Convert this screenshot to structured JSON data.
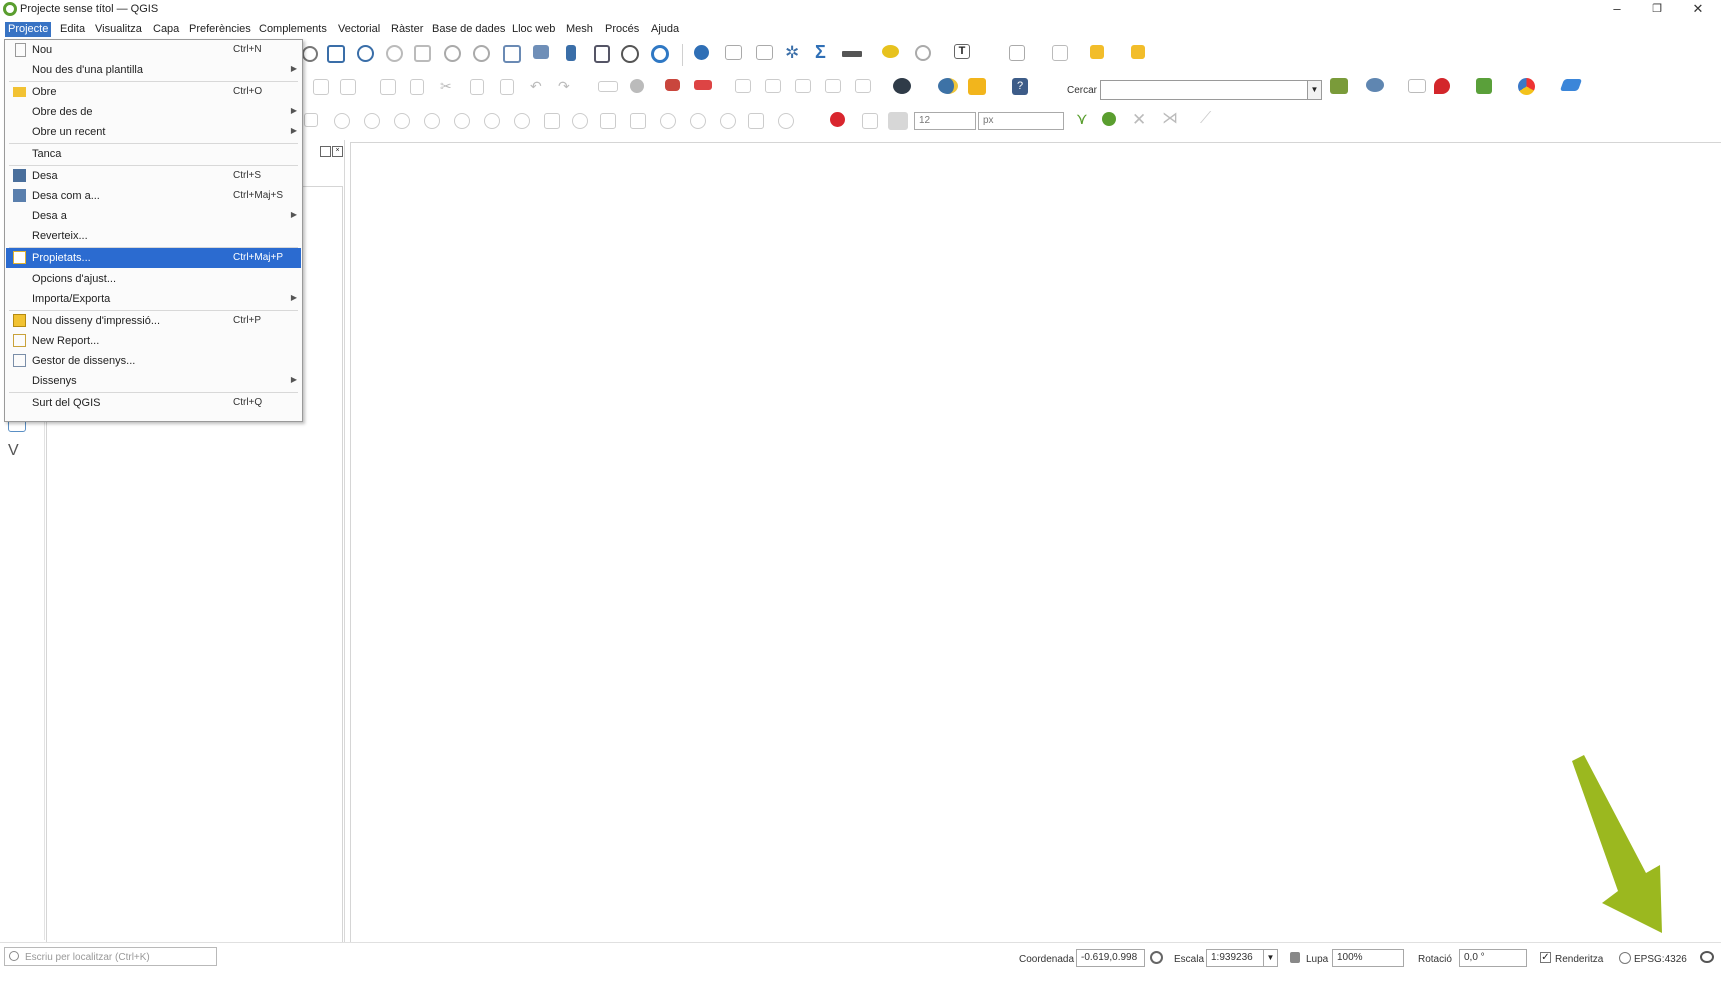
{
  "window": {
    "title": "Projecte sense títol — QGIS",
    "minimize": "–",
    "maximize": "❐",
    "close": "✕"
  },
  "menubar": {
    "items": [
      "Projecte",
      "Edita",
      "Visualitza",
      "Capa",
      "Preferències",
      "Complements",
      "Vectorial",
      "Ràster",
      "Base de dades",
      "Lloc web",
      "Mesh",
      "Procés",
      "Ajuda"
    ],
    "active": "Projecte"
  },
  "project_menu": {
    "items": [
      {
        "label": "Nou",
        "shortcut": "Ctrl+N",
        "icon": "new-document-icon"
      },
      {
        "label": "Nou des d'una plantilla",
        "submenu": true
      },
      {
        "label": "Obre",
        "shortcut": "Ctrl+O",
        "icon": "folder-icon"
      },
      {
        "label": "Obre des de",
        "submenu": true
      },
      {
        "label": "Obre un recent",
        "submenu": true
      },
      {
        "label": "Tanca"
      },
      {
        "label": "Desa",
        "shortcut": "Ctrl+S",
        "icon": "save-icon"
      },
      {
        "label": "Desa com a...",
        "shortcut": "Ctrl+Maj+S",
        "icon": "save-as-icon"
      },
      {
        "label": "Desa a",
        "submenu": true
      },
      {
        "label": "Reverteix..."
      },
      {
        "label": "Propietats...",
        "shortcut": "Ctrl+Maj+P",
        "icon": "properties-icon",
        "highlighted": true
      },
      {
        "label": "Opcions d'ajust..."
      },
      {
        "label": "Importa/Exporta",
        "submenu": true
      },
      {
        "label": "Nou disseny d'impressió...",
        "shortcut": "Ctrl+P",
        "icon": "new-print-layout-icon"
      },
      {
        "label": "New Report...",
        "icon": "new-report-icon"
      },
      {
        "label": "Gestor de dissenys...",
        "icon": "layout-manager-icon"
      },
      {
        "label": "Dissenys",
        "submenu": true
      },
      {
        "label": "Surt del QGIS",
        "shortcut": "Ctrl+Q"
      }
    ]
  },
  "toolbar": {
    "search_label": "Cercar",
    "search_value": "",
    "snap_tolerance": "12",
    "snap_unit": "px"
  },
  "statusbar": {
    "locator_placeholder": "Escriu per localitzar (Ctrl+K)",
    "coord_label": "Coordenada",
    "coord_value": "-0.619,0.998",
    "scale_label": "Escala",
    "scale_value": "1:939236",
    "magnifier_label": "Lupa",
    "magnifier_value": "100%",
    "rotation_label": "Rotació",
    "rotation_value": "0,0 °",
    "render_label": "Renderitza",
    "render_checked": true,
    "crs": "EPSG:4326"
  },
  "colors": {
    "menu_active": "#3873c4",
    "menu_highlight": "#2b6bd0",
    "arrow": "#9bb81f",
    "qgis_green": "#5a9e2f"
  }
}
